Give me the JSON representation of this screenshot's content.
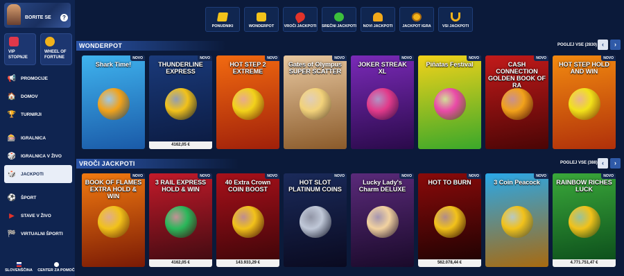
{
  "sidebar": {
    "promo_label": "BORITE SE",
    "help_icon": "?",
    "tiles": [
      {
        "label": "VIP STOPNJE",
        "icon": "vip-icon",
        "color": "#e0384a"
      },
      {
        "label": "WHEEL OF FORTUNE",
        "icon": "wheel-icon",
        "color": "#f2b21a"
      }
    ],
    "nav": [
      {
        "label": "PROMOCIJE",
        "icon": "megaphone-icon",
        "glyph": "📢",
        "active": false
      },
      {
        "label": "DOMOV",
        "icon": "home-icon",
        "glyph": "🏠",
        "active": false
      },
      {
        "label": "TURNIRJI",
        "icon": "trophy-icon",
        "glyph": "🏆",
        "active": false
      },
      {
        "label": "IGRALNICA",
        "icon": "roulette-icon",
        "glyph": "🎰",
        "active": false
      },
      {
        "label": "IGRALNICA V ŽIVO",
        "icon": "dice-icon",
        "glyph": "🎲",
        "active": false
      },
      {
        "label": "JACKPOTI",
        "icon": "jackpot-icon",
        "glyph": "🎲",
        "active": true
      },
      {
        "label": "ŠPORT",
        "icon": "ball-icon",
        "glyph": "⚽",
        "active": false
      },
      {
        "label": "STAVE V ŽIVO",
        "icon": "live-icon",
        "glyph": "▶",
        "active": false
      },
      {
        "label": "VIRTUALNI ŠPORTI",
        "icon": "virtual-icon",
        "glyph": "🏁",
        "active": false
      }
    ],
    "footer": {
      "language": "SLOVENŠČINA",
      "help": "CENTER ZA POMOČ"
    }
  },
  "tabs": [
    {
      "label": "PONUDNIKI",
      "icon": "providers-icon",
      "color": "#f2c21a"
    },
    {
      "label": "WONDERPOT",
      "icon": "wonderpot-icon",
      "color": "#f2c21a"
    },
    {
      "label": "VROČI JACKPOTI",
      "icon": "chili-icon",
      "color": "#e2332a"
    },
    {
      "label": "SREČNI JACKPOTI",
      "icon": "clover-icon",
      "color": "#3cbf3c"
    },
    {
      "label": "NOVI JACKPOTI",
      "icon": "bell-icon",
      "color": "#f2a91a"
    },
    {
      "label": "JACKPOT IGRA",
      "icon": "coin-icon",
      "color": "#f2b21a"
    },
    {
      "label": "VSI JACKPOTI",
      "icon": "horseshoe-icon",
      "color": "#f2b21a"
    }
  ],
  "sections": [
    {
      "title": "WONDERPOT",
      "see_all": "POGLEJ VSE (2830)",
      "games": [
        {
          "title": "Shark Time!",
          "badge": "NOVO",
          "jackpot": "",
          "c1": "#3fb3ee",
          "c2": "#1a5aa8",
          "orb": "#f2a21a"
        },
        {
          "title": "THUNDERLINE EXPRESS",
          "badge": "NOVO",
          "jackpot": "4162,05 €",
          "c1": "#1a3a7a",
          "c2": "#0b1a40",
          "orb": "#f2c21a"
        },
        {
          "title": "HOT STEP 2 EXTREME",
          "badge": "NOVO",
          "jackpot": "",
          "c1": "#f26a10",
          "c2": "#a0200a",
          "orb": "#f2d21a"
        },
        {
          "title": "Gates of Olympus SUPER SCATTER",
          "badge": "NOVO",
          "jackpot": "",
          "c1": "#e8c8a0",
          "c2": "#8a5a2a",
          "orb": "#f2d27a"
        },
        {
          "title": "JOKER STREAK XL",
          "badge": "NOVO",
          "jackpot": "",
          "c1": "#7a2ab8",
          "c2": "#2a0a4a",
          "orb": "#e23a8a"
        },
        {
          "title": "Piñatas Festival",
          "badge": "NOVO",
          "jackpot": "",
          "c1": "#f2d21a",
          "c2": "#3aa82a",
          "orb": "#ea4aa8"
        },
        {
          "title": "CASH CONNECTION GOLDEN BOOK OF RA",
          "badge": "NOVO",
          "jackpot": "",
          "c1": "#c21a1a",
          "c2": "#4a0505",
          "orb": "#f2a21a"
        },
        {
          "title": "HOT STEP HOLD AND WIN",
          "badge": "NOVO",
          "jackpot": "",
          "c1": "#f28a10",
          "c2": "#b0300a",
          "orb": "#f2e21a"
        }
      ]
    },
    {
      "title": "VROČI JACKPOTI",
      "see_all": "POGLEJ VSE (388)",
      "games": [
        {
          "title": "BOOK OF FLAMES EXTRA HOLD & WIN",
          "badge": "NOVO",
          "jackpot": "",
          "c1": "#f27a10",
          "c2": "#7a1a05",
          "orb": "#f2c21a"
        },
        {
          "title": "3 RAIL EXPRESS HOLD & WIN",
          "badge": "NOVO",
          "jackpot": "4162,05 €",
          "c1": "#c21a2a",
          "c2": "#3a0a10",
          "orb": "#2ab85a"
        },
        {
          "title": "40 Extra Crown COIN BOOST",
          "badge": "NOVO",
          "jackpot": "143.933,29 €",
          "c1": "#a8101a",
          "c2": "#3a0508",
          "orb": "#f2c21a"
        },
        {
          "title": "HOT SLOT PLATINUM COINS",
          "badge": "NOVO",
          "jackpot": "",
          "c1": "#1a2a5a",
          "c2": "#0a0a20",
          "orb": "#c0c8d8"
        },
        {
          "title": "Lucky Lady's Charm DELUXE",
          "badge": "NOVO",
          "jackpot": "",
          "c1": "#5a2a7a",
          "c2": "#1a0a2a",
          "orb": "#f2d2a0"
        },
        {
          "title": "HOT TO BURN",
          "badge": "NOVO",
          "jackpot": "562.078,44 €",
          "c1": "#8a0a0a",
          "c2": "#1a0202",
          "orb": "#f2c21a"
        },
        {
          "title": "3 Coin Peacock",
          "badge": "NOVO",
          "jackpot": "",
          "c1": "#2aa8e8",
          "c2": "#a86a10",
          "orb": "#f2c21a"
        },
        {
          "title": "RAINBOW RICHES LUCK",
          "badge": "NOVO",
          "jackpot": "4.771.751,47 €",
          "c1": "#3aa83a",
          "c2": "#0a4a1a",
          "orb": "#f2c21a"
        }
      ]
    }
  ]
}
